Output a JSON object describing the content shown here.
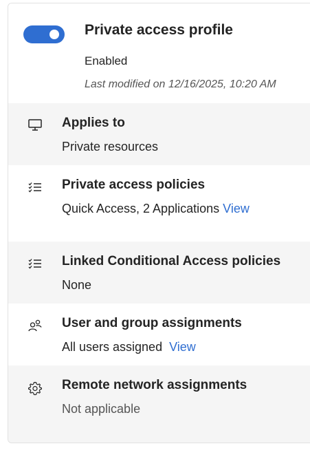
{
  "profile": {
    "title": "Private access profile",
    "status": "Enabled",
    "last_modified": "Last modified on 12/16/2025, 10:20 AM",
    "toggle_on": true
  },
  "sections": [
    {
      "icon": "monitor-icon",
      "title": "Applies to",
      "value": "Private resources"
    },
    {
      "icon": "policy-list-icon",
      "title": "Private access policies",
      "value": "Quick Access, 2 Applications",
      "link": "View"
    },
    {
      "icon": "policy-list-icon",
      "title": "Linked Conditional Access policies",
      "value": "None"
    },
    {
      "icon": "users-icon",
      "title": "User and group assignments",
      "value": "All users assigned",
      "link": "View"
    },
    {
      "icon": "gear-icon",
      "title": "Remote network assignments",
      "value": "Not applicable"
    }
  ],
  "colors": {
    "accent": "#2f6ed1",
    "alt_background": "#f5f5f5"
  }
}
